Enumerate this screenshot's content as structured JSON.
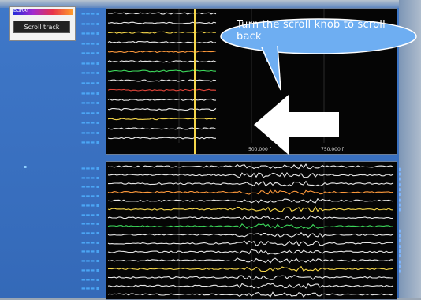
{
  "palette": {
    "gradient_label": "BGRAY",
    "scroll_button_label": "Scroll track"
  },
  "callout": {
    "text": "Turn the scroll knob to scroll back"
  },
  "top_plot": {
    "x_ticks": [
      "500.000 f",
      "750.000 f"
    ]
  },
  "colors": {
    "screen_bg": "#3a72c2",
    "plot_bg": "#050505",
    "trace_white": "#e8e8e8",
    "trace_yellow": "#f5d64a",
    "trace_green": "#3cd65a",
    "trace_orange": "#ff9a3c",
    "trace_red": "#e0453a",
    "arrow": "#ffffff"
  },
  "icons": {
    "arrow": "arrow-left-icon"
  }
}
